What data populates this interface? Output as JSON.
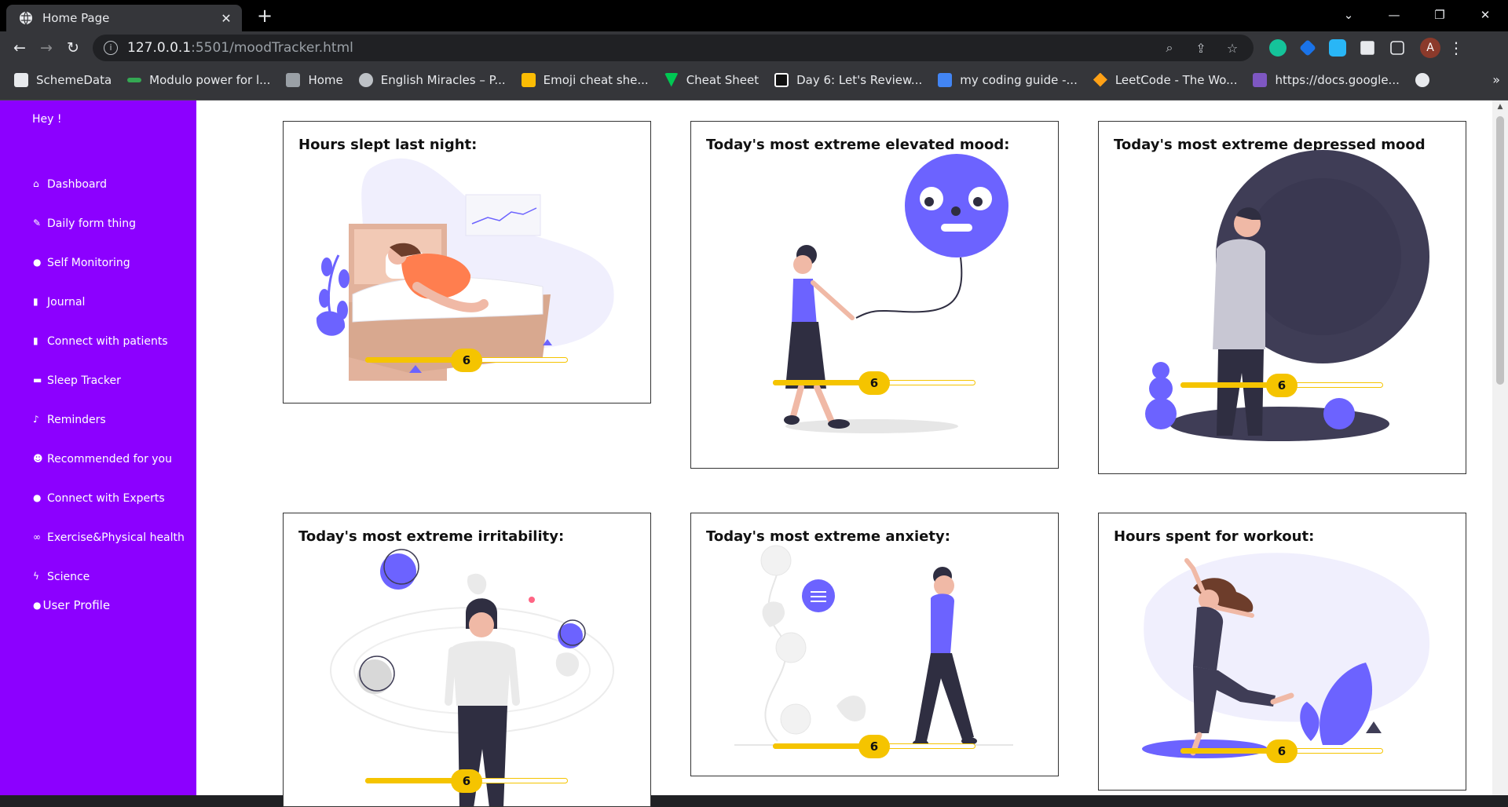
{
  "browser": {
    "tab_title": "Home Page",
    "url_host": "127.0.0.1",
    "url_path": ":5501/moodTracker.html",
    "avatar_letter": "A",
    "bookmarks": [
      {
        "label": "SchemeData",
        "color": "#e8eaed"
      },
      {
        "label": "Modulo power for l...",
        "color": "#34a853"
      },
      {
        "label": "Home",
        "color": "#9aa0a6"
      },
      {
        "label": "English Miracles – P...",
        "color": "#bdc1c6"
      },
      {
        "label": "Emoji cheat she...",
        "color": "#fbbc04"
      },
      {
        "label": "Cheat Sheet",
        "color": "#00c853"
      },
      {
        "label": "Day 6: Let's Review...",
        "color": "#ffffff"
      },
      {
        "label": "my coding guide -...",
        "color": "#4285f4"
      },
      {
        "label": "LeetCode - The Wo...",
        "color": "#ffa116"
      },
      {
        "label": "https://docs.google...",
        "color": "#7e57c2"
      }
    ]
  },
  "sidebar": {
    "greeting": "Hey !",
    "items": [
      {
        "label": "Dashboard",
        "icon": "home-icon"
      },
      {
        "label": "Daily form thing",
        "icon": "pencil-icon"
      },
      {
        "label": "Self Monitoring",
        "icon": "person-icon"
      },
      {
        "label": "Journal",
        "icon": "book-icon"
      },
      {
        "label": "Connect with patients",
        "icon": "book-icon"
      },
      {
        "label": "Sleep Tracker",
        "icon": "bed-icon"
      },
      {
        "label": "Reminders",
        "icon": "bell-icon"
      },
      {
        "label": "Recommended for you",
        "icon": "smile-icon"
      },
      {
        "label": "Connect with Experts",
        "icon": "person-icon"
      },
      {
        "label": "Exercise&Physical health",
        "icon": "bike-icon"
      },
      {
        "label": "Science",
        "icon": "bolt-icon"
      }
    ],
    "profile_label": "User Profile",
    "accent": "#8c00ff"
  },
  "cards": [
    {
      "title": "Hours slept last night:",
      "value": "6",
      "fraction": 0.5
    },
    {
      "title": "Today's most extreme elevated mood:",
      "value": "6",
      "fraction": 0.5
    },
    {
      "title": "Today's most extreme depressed mood",
      "value": "6",
      "fraction": 0.5
    },
    {
      "title": "Today's most extreme irritability:",
      "value": "6",
      "fraction": 0.5
    },
    {
      "title": "Today's most extreme anxiety:",
      "value": "6",
      "fraction": 0.5
    },
    {
      "title": "Hours spent for workout:",
      "value": "6",
      "fraction": 0.5
    }
  ],
  "colors": {
    "slider": "#f5c400",
    "illustration": "#6c63ff"
  }
}
